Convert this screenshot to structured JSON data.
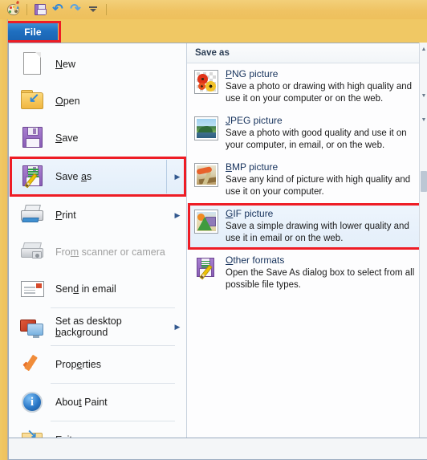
{
  "window": {
    "quick_access": [
      {
        "name": "paint-app-icon",
        "label": "Paint"
      },
      {
        "name": "save-icon",
        "label": "Save"
      },
      {
        "name": "undo-icon",
        "label": "Undo"
      },
      {
        "name": "redo-icon",
        "label": "Redo"
      },
      {
        "name": "customize-quick-access-toolbar-icon",
        "label": "Customize Quick Access Toolbar"
      }
    ]
  },
  "file_tab": {
    "label": "File",
    "highlighted": true,
    "accent_color": "#1f6fc0",
    "highlight_color": "#ee1c25"
  },
  "menu": {
    "items": [
      {
        "label": "New",
        "key": "N",
        "icon": "new-page-icon",
        "submenu": false,
        "disabled": false,
        "selected": false
      },
      {
        "label": "Open",
        "key": "O",
        "icon": "open-folder-icon",
        "submenu": false,
        "disabled": false,
        "selected": false
      },
      {
        "label": "Save",
        "key": "S",
        "icon": "save-floppy-icon",
        "submenu": false,
        "disabled": false,
        "selected": false
      },
      {
        "label": "Save as",
        "key": "a",
        "icon": "save-as-floppy-icon",
        "submenu": true,
        "disabled": false,
        "selected": true
      },
      {
        "label": "Print",
        "key": "P",
        "icon": "printer-icon",
        "submenu": true,
        "disabled": false,
        "selected": false
      },
      {
        "label": "From scanner or camera",
        "key": "m",
        "icon": "scanner-camera-icon",
        "submenu": false,
        "disabled": true,
        "selected": false
      },
      {
        "label": "Send in email",
        "key": "d",
        "icon": "envelope-icon",
        "submenu": false,
        "disabled": false,
        "selected": false
      },
      {
        "label": "Set as desktop background",
        "key": "b",
        "icon": "desktop-monitors-icon",
        "submenu": true,
        "disabled": false,
        "selected": false
      },
      {
        "label": "Properties",
        "key": "e",
        "icon": "checkmark-icon",
        "submenu": false,
        "disabled": false,
        "selected": false
      },
      {
        "label": "About Paint",
        "key": "t",
        "icon": "info-circle-icon",
        "submenu": false,
        "disabled": false,
        "selected": false
      },
      {
        "label": "Exit",
        "key": "x",
        "icon": "exit-folder-icon",
        "submenu": false,
        "disabled": false,
        "selected": false
      }
    ],
    "labels": {
      "new_pre": "",
      "new_key": "N",
      "new_post": "ew",
      "open_pre": "",
      "open_key": "O",
      "open_post": "pen",
      "save_pre": "",
      "save_key": "S",
      "save_post": "ave",
      "saveas_pre": "Save ",
      "saveas_key": "a",
      "saveas_post": "s",
      "print_pre": "",
      "print_key": "P",
      "print_post": "rint",
      "scanner_pre": "Fro",
      "scanner_key": "m",
      "scanner_post": " scanner or camera",
      "email_pre": "Sen",
      "email_key": "d",
      "email_post": " in email",
      "desktop_pre": "Set as desktop ",
      "desktop_key": "b",
      "desktop_post": "ackground",
      "properties_pre": "Prop",
      "properties_key": "e",
      "properties_post": "rties",
      "about_pre": "Abou",
      "about_key": "t",
      "about_post": " Paint",
      "exit_pre": "E",
      "exit_key": "x",
      "exit_post": "it"
    },
    "submenu_arrow": "▶"
  },
  "save_as_panel": {
    "header": "Save as",
    "formats": [
      {
        "title_pre": "",
        "title_key": "P",
        "title_post": "NG picture",
        "title": "PNG picture",
        "desc": "Save a photo or drawing with high quality and use it on your computer or on the web.",
        "icon": "png-picture-thumbnail",
        "selected": false
      },
      {
        "title_pre": "",
        "title_key": "J",
        "title_post": "PEG picture",
        "title": "JPEG picture",
        "desc": "Save a photo with good quality and use it on your computer, in email, or on the web.",
        "icon": "jpeg-picture-thumbnail",
        "selected": false
      },
      {
        "title_pre": "",
        "title_key": "B",
        "title_post": "MP picture",
        "title": "BMP picture",
        "desc": "Save any kind of picture with high quality and use it on your computer.",
        "icon": "bmp-picture-thumbnail",
        "selected": false
      },
      {
        "title_pre": "",
        "title_key": "G",
        "title_post": "IF picture",
        "title": "GIF picture",
        "desc": "Save a simple drawing with lower quality and use it in email or on the web.",
        "icon": "gif-picture-thumbnail",
        "selected": true
      },
      {
        "title_pre": "",
        "title_key": "O",
        "title_post": "ther formats",
        "title": "Other formats",
        "desc": "Open the Save As dialog box to select from all possible file types.",
        "icon": "other-formats-floppy-icon",
        "selected": false
      }
    ]
  },
  "scrollbar": {
    "up_arrow": "▲",
    "down_arrow": "▼"
  },
  "highlights": {
    "color": "#ee1c25",
    "targets": [
      "file-tab",
      "save-as-menu-item",
      "gif-picture-option"
    ]
  }
}
